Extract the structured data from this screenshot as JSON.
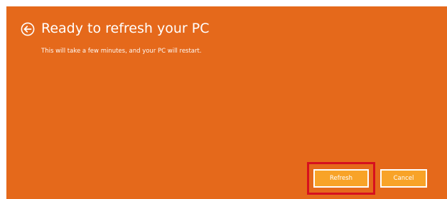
{
  "page": {
    "title": "Ready to refresh your PC",
    "subtitle": "This will take a few minutes, and your PC will restart."
  },
  "buttons": {
    "refresh_label": "Refresh",
    "cancel_label": "Cancel"
  },
  "icons": {
    "back": "back-arrow-circle-icon"
  },
  "colors": {
    "background": "#e5691b",
    "button_fill": "#f8a328",
    "button_border": "#ffffff",
    "highlight": "#d6101f",
    "text": "#ffffff"
  }
}
